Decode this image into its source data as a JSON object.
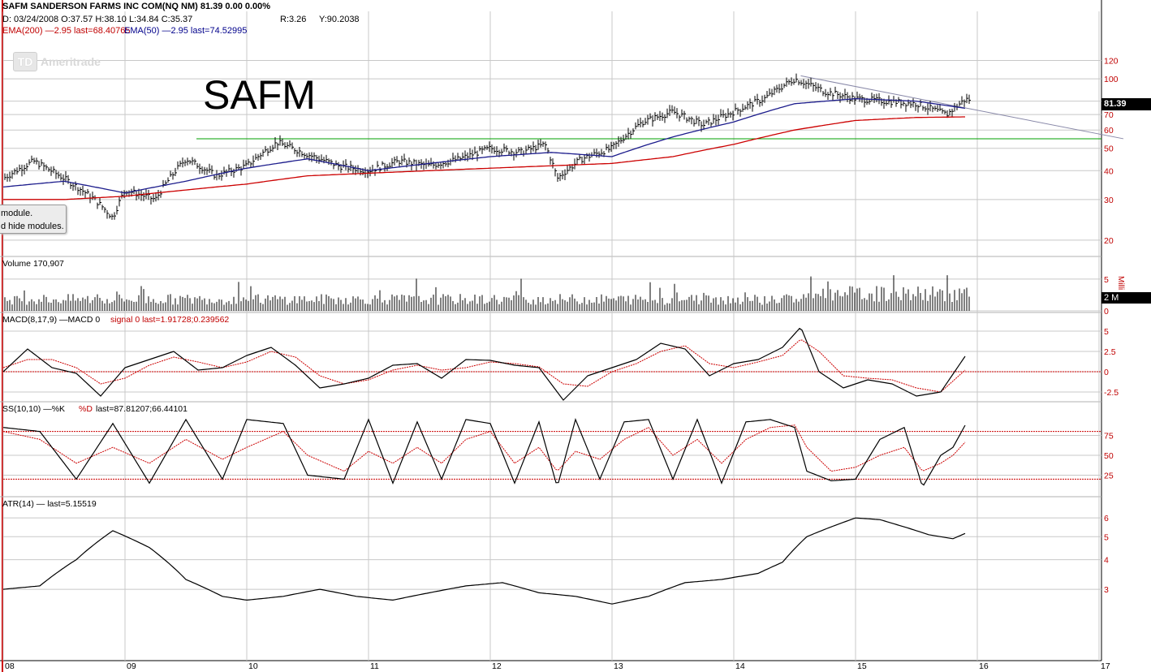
{
  "header": {
    "symbol_line": "SAFM SANDERSON FARMS INC COM(NQ NM)  81.39  0.00  0.00%",
    "ohlc_line": "D: 03/24/2008 O:37.57 H:38.10 L:34.84 C:35.37",
    "r_value": "R:3.26",
    "y_value": "Y:90.2038",
    "ema200_label": "EMA(200) —2.95 last=68.40765",
    "ema50_label": "EMA(50) —2.95 last=74.52995"
  },
  "brand": {
    "logo_mark": "TD",
    "logo_text": "Ameritrade"
  },
  "ticker_text": "SAFM",
  "tooltip": {
    "line1": "module.",
    "line2": "d hide modules."
  },
  "price_tag": "81.39",
  "volume_tag": "2 M",
  "volume_axis_unit": "Milli",
  "panels": {
    "volume": "Volume 170,907",
    "macd_a": "MACD(8,17,9) —MACD 0",
    "macd_b": "signal 0 last=1.91728;0.239562",
    "ss_a": "SS(10,10) —%K",
    "ss_b": "%D",
    "ss_c": "last=87.81207;66.44101",
    "atr": "ATR(14) — last=5.15519"
  },
  "colors": {
    "ema200": "#cc0000",
    "ema50": "#1c1c8c",
    "support_line": "#00a000",
    "trend_line": "#8888a8",
    "signal": "#cc0000",
    "grid": "#c8c8c8",
    "left_border": "#cc0000"
  },
  "chart_data": [
    {
      "type": "line",
      "title": "SAFM",
      "x_axis_labels": [
        "08",
        "09",
        "10",
        "11",
        "12",
        "13",
        "14",
        "15",
        "16",
        "17"
      ],
      "y_tick_labels": [
        "120",
        "100",
        "80",
        "70",
        "60",
        "50",
        "40",
        "30",
        "20"
      ],
      "scale": "log",
      "ylim": [
        17,
        135
      ],
      "series": [
        {
          "name": "Price (approx. close)",
          "x": [
            8.0,
            8.25,
            8.5,
            8.75,
            8.9,
            9.0,
            9.25,
            9.5,
            9.75,
            10.0,
            10.25,
            10.5,
            10.75,
            11.0,
            11.25,
            11.5,
            11.75,
            12.0,
            12.25,
            12.45,
            12.55,
            12.75,
            13.0,
            13.25,
            13.5,
            13.75,
            14.0,
            14.25,
            14.5,
            14.75,
            15.0,
            15.25,
            15.5,
            15.75,
            15.9
          ],
          "y": [
            37,
            44,
            37,
            30,
            25,
            33,
            30,
            45,
            38,
            42,
            53,
            47,
            42,
            40,
            44,
            42,
            45,
            50,
            48,
            52,
            37,
            45,
            50,
            65,
            72,
            63,
            72,
            82,
            100,
            88,
            82,
            80,
            78,
            70,
            81.39
          ]
        },
        {
          "name": "EMA(200)",
          "x": [
            8.0,
            8.5,
            9.0,
            9.5,
            10.0,
            10.5,
            11.0,
            11.5,
            12.0,
            12.5,
            13.0,
            13.5,
            14.0,
            14.5,
            15.0,
            15.5,
            15.9
          ],
          "y": [
            30,
            30,
            31,
            33,
            35,
            38,
            39,
            40,
            41,
            42,
            43,
            46,
            52,
            60,
            66,
            68,
            68.4
          ]
        },
        {
          "name": "EMA(50)",
          "x": [
            8.0,
            8.5,
            9.0,
            9.5,
            10.0,
            10.5,
            11.0,
            11.5,
            12.0,
            12.5,
            13.0,
            13.5,
            14.0,
            14.5,
            15.0,
            15.5,
            15.9
          ],
          "y": [
            34,
            36,
            32,
            36,
            41,
            45,
            40,
            43,
            46,
            48,
            46,
            56,
            65,
            78,
            82,
            80,
            74.5
          ]
        }
      ],
      "horizontal_line": 55,
      "trend_line": {
        "from": [
          14.55,
          103
        ],
        "to": [
          17.2,
          55
        ]
      }
    },
    {
      "type": "bar",
      "title": "Volume 170,907",
      "y_tick_labels": [
        "5",
        "0"
      ],
      "ylim": [
        0,
        6
      ],
      "unit": "Milli"
    },
    {
      "type": "line",
      "title": "MACD(8,17,9)",
      "y_tick_labels": [
        "5",
        "2.5",
        "0",
        "-2.5"
      ],
      "ylim": [
        -3.6,
        5.8
      ],
      "series": [
        {
          "name": "MACD",
          "x": [
            8.0,
            8.2,
            8.4,
            8.6,
            8.8,
            9.0,
            9.2,
            9.4,
            9.6,
            9.8,
            10.0,
            10.2,
            10.4,
            10.6,
            10.8,
            11.0,
            11.2,
            11.4,
            11.6,
            11.8,
            12.0,
            12.2,
            12.4,
            12.6,
            12.8,
            13.0,
            13.2,
            13.4,
            13.6,
            13.8,
            14.0,
            14.2,
            14.4,
            14.55,
            14.7,
            14.9,
            15.1,
            15.3,
            15.5,
            15.7,
            15.9
          ],
          "y": [
            0,
            2.8,
            0.5,
            -0.2,
            -3,
            0.5,
            1.5,
            2.5,
            0.2,
            0.5,
            2,
            3,
            0.8,
            -2,
            -1.5,
            -0.8,
            0.8,
            1,
            -0.8,
            1.5,
            1.4,
            0.8,
            0.5,
            -3.5,
            -0.5,
            0.5,
            1.5,
            3.5,
            2.8,
            -0.5,
            1,
            1.5,
            3,
            5.5,
            0,
            -2,
            -1,
            -1.5,
            -3,
            -2.5,
            1.9
          ]
        },
        {
          "name": "signal",
          "x": [
            8.0,
            8.2,
            8.4,
            8.6,
            8.8,
            9.0,
            9.2,
            9.4,
            9.6,
            9.8,
            10.0,
            10.2,
            10.4,
            10.6,
            10.8,
            11.0,
            11.2,
            11.4,
            11.6,
            11.8,
            12.0,
            12.2,
            12.4,
            12.6,
            12.8,
            13.0,
            13.2,
            13.4,
            13.6,
            13.8,
            14.0,
            14.2,
            14.4,
            14.55,
            14.7,
            14.9,
            15.1,
            15.3,
            15.5,
            15.7,
            15.9
          ],
          "y": [
            0.5,
            1.5,
            1.5,
            0.5,
            -1.5,
            -0.8,
            0.8,
            1.8,
            1.2,
            0.5,
            1.2,
            2.5,
            1.8,
            -0.5,
            -1.5,
            -1,
            0.2,
            0.8,
            0.2,
            0.5,
            1.2,
            1,
            0.6,
            -1.5,
            -1.8,
            0,
            1,
            2.5,
            3.2,
            1,
            0.5,
            1.2,
            2,
            4,
            2.5,
            -0.5,
            -0.8,
            -1,
            -2,
            -2.5,
            0.2
          ]
        }
      ]
    },
    {
      "type": "line",
      "title": "SS(10,10)",
      "y_tick_labels": [
        "75",
        "50",
        "25"
      ],
      "ylim": [
        0,
        100
      ],
      "series": [
        {
          "name": "%K",
          "x": [
            8.0,
            8.3,
            8.6,
            8.9,
            9.2,
            9.5,
            9.8,
            10.0,
            10.3,
            10.5,
            10.8,
            11.0,
            11.2,
            11.4,
            11.6,
            11.8,
            12.0,
            12.2,
            12.4,
            12.55,
            12.7,
            12.9,
            13.1,
            13.3,
            13.5,
            13.7,
            13.9,
            14.1,
            14.3,
            14.5,
            14.6,
            14.8,
            15.0,
            15.2,
            15.4,
            15.55,
            15.7,
            15.8,
            15.9
          ],
          "y": [
            85,
            80,
            20,
            90,
            15,
            95,
            20,
            95,
            90,
            25,
            20,
            95,
            15,
            92,
            20,
            95,
            90,
            15,
            92,
            10,
            95,
            20,
            92,
            95,
            20,
            95,
            15,
            92,
            95,
            85,
            30,
            18,
            20,
            70,
            85,
            10,
            50,
            60,
            87.8
          ]
        },
        {
          "name": "%D",
          "x": [
            8.0,
            8.3,
            8.6,
            8.9,
            9.2,
            9.5,
            9.8,
            10.0,
            10.3,
            10.5,
            10.8,
            11.0,
            11.2,
            11.4,
            11.6,
            11.8,
            12.0,
            12.2,
            12.4,
            12.55,
            12.7,
            12.9,
            13.1,
            13.3,
            13.5,
            13.7,
            13.9,
            14.1,
            14.3,
            14.5,
            14.6,
            14.8,
            15.0,
            15.2,
            15.4,
            15.55,
            15.7,
            15.8,
            15.9
          ],
          "y": [
            80,
            70,
            40,
            60,
            40,
            70,
            45,
            60,
            80,
            50,
            30,
            55,
            40,
            60,
            40,
            70,
            80,
            40,
            60,
            30,
            55,
            45,
            70,
            85,
            50,
            70,
            40,
            70,
            85,
            88,
            60,
            30,
            35,
            50,
            60,
            30,
            40,
            50,
            66.4
          ]
        }
      ]
    },
    {
      "type": "line",
      "title": "ATR(14)",
      "y_tick_labels": [
        "6",
        "5",
        "4",
        "3"
      ],
      "scale": "log",
      "ylim": [
        1.5,
        6.5
      ],
      "series": [
        {
          "name": "ATR",
          "x": [
            8.0,
            8.3,
            8.6,
            8.9,
            9.2,
            9.5,
            9.8,
            10.0,
            10.3,
            10.6,
            10.9,
            11.2,
            11.5,
            11.8,
            12.1,
            12.4,
            12.7,
            13.0,
            13.3,
            13.6,
            13.9,
            14.2,
            14.4,
            14.6,
            14.8,
            15.0,
            15.2,
            15.4,
            15.6,
            15.8,
            15.9
          ],
          "y": [
            3,
            3.1,
            4,
            5.3,
            4.5,
            3.3,
            2.8,
            2.7,
            2.8,
            3,
            2.8,
            2.7,
            2.9,
            3.1,
            3.2,
            2.9,
            2.8,
            2.6,
            2.8,
            3.2,
            3.3,
            3.5,
            3.9,
            5,
            5.5,
            6,
            5.9,
            5.5,
            5.1,
            4.9,
            5.16
          ]
        }
      ]
    }
  ]
}
